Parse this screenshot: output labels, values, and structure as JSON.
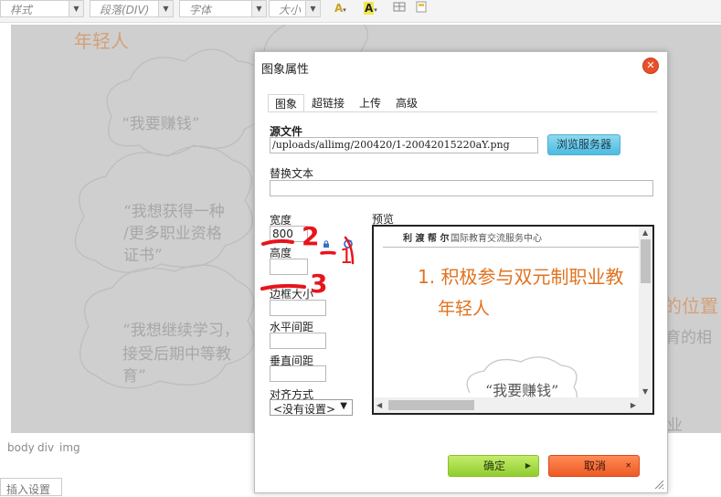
{
  "toolbar": {
    "style_combo": "样式",
    "format_combo": "段落(DIV)",
    "font_combo": "字体",
    "size_combo": "大小",
    "font_color_label": "A",
    "bg_color_label": "A"
  },
  "editor": {
    "bg_texts": [
      "年轻人",
      "“我要赚钱”",
      "“我想获得一种",
      "/更多职业资格",
      "证书”",
      "“我想继续学习，",
      "接受后期中等教",
      "育”",
      "的位置",
      "育的相",
      "业"
    ],
    "status_path": [
      "body",
      "div",
      "img"
    ],
    "bottom_tab": "插入设置"
  },
  "dialog": {
    "title": "图象属性",
    "close_glyph": "✕",
    "tabs": [
      "图象",
      "超链接",
      "上传",
      "高级"
    ],
    "source_label": "源文件",
    "source_value": "/uploads/allimg/200420/1-20042015220aY.png",
    "browse_button": "浏览服务器",
    "alt_label": "替换文本",
    "alt_value": "",
    "width_label": "宽度",
    "width_value": "800",
    "height_label": "高度",
    "height_value": "",
    "border_label": "边框大小",
    "border_value": "",
    "hspace_label": "水平间距",
    "hspace_value": "",
    "vspace_label": "垂直间距",
    "vspace_value": "",
    "align_label": "对齐方式",
    "align_value": "<没有设置>",
    "preview_label": "预览",
    "preview": {
      "logo_text": "利 渡 帮 尔",
      "header_text": "国际教育交流服务中心",
      "heading": "1. 积极参与双元制职业教",
      "subheading": "年轻人",
      "cloud_text": "“我要赚钱”"
    },
    "ok_button": "确定",
    "cancel_button": "取消"
  },
  "annotations": [
    "2",
    "3",
    "1"
  ],
  "colors": {
    "ok_green": "#a6dd45",
    "cancel_orange": "#f36a30",
    "browse_blue": "#6ccbea",
    "close_red": "#e8502a",
    "preview_orange": "#e07320",
    "annotation_red": "#e8141c"
  }
}
